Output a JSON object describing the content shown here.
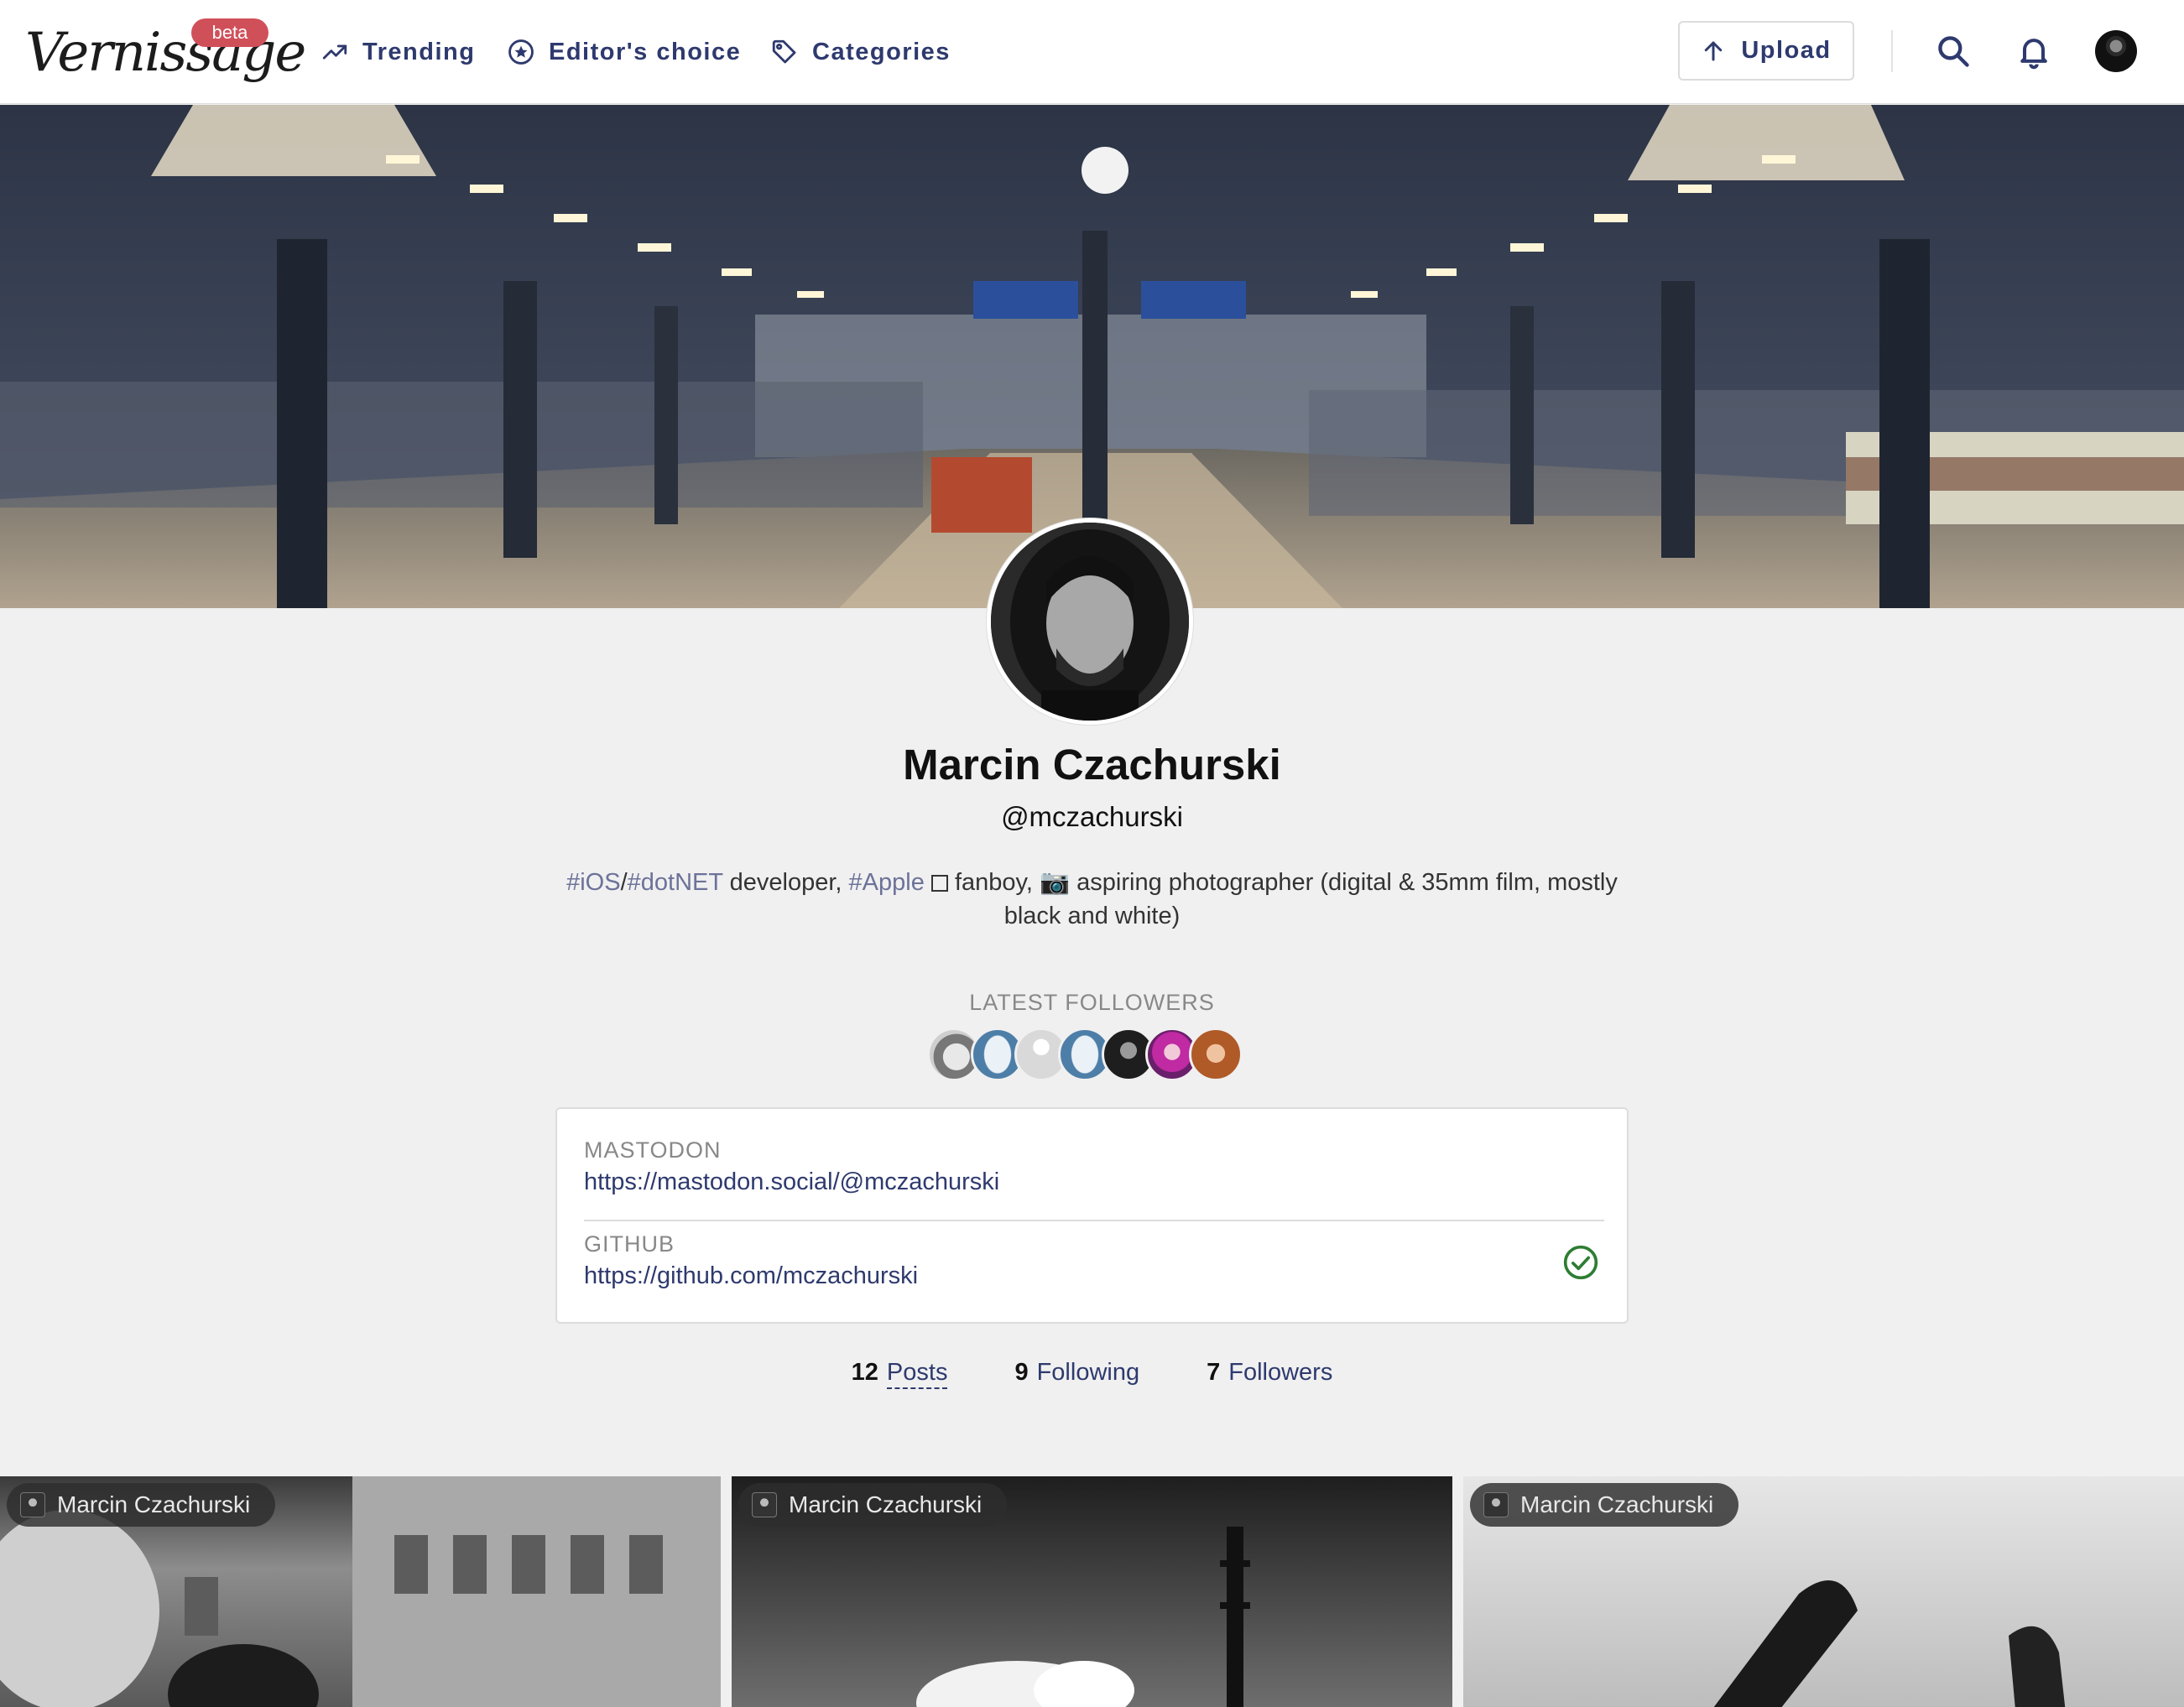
{
  "navbar": {
    "logo": "Vernissage",
    "beta_label": "beta",
    "links": [
      {
        "label": "Trending",
        "icon": "trending-up-icon"
      },
      {
        "label": "Editor's choice",
        "icon": "star-circle-icon"
      },
      {
        "label": "Categories",
        "icon": "tag-icon"
      }
    ],
    "upload_label": "Upload",
    "search_icon": "search-icon",
    "notifications_icon": "bell-icon",
    "avatar": "user-avatar"
  },
  "profile": {
    "name": "Marcin Czachurski",
    "handle": "@mczachurski",
    "bio": {
      "tag_ios": "#iOS",
      "slash": "/",
      "tag_dotnet": "#dotNET",
      "text1": " developer, ",
      "tag_apple": "#Apple",
      "text2": " fanboy, 📷 aspiring photographer (digital & 35mm film, mostly black and white)"
    }
  },
  "latest_followers": {
    "title": "LATEST FOLLOWERS",
    "count_shown": 7
  },
  "fields": [
    {
      "name": "MASTODON",
      "value": "https://mastodon.social/@mczachurski",
      "verified": false
    },
    {
      "name": "GITHUB",
      "value": "https://github.com/mczachurski",
      "verified": true
    }
  ],
  "stats": {
    "posts": {
      "count": "12",
      "label": "Posts"
    },
    "following": {
      "count": "9",
      "label": "Following"
    },
    "followers": {
      "count": "7",
      "label": "Followers"
    }
  },
  "posts": [
    {
      "author": "Marcin Czachurski"
    },
    {
      "author": "Marcin Czachurski"
    },
    {
      "author": "Marcin Czachurski"
    }
  ],
  "colors": {
    "accent": "#2e3a6e",
    "beta_badge": "#d0505a",
    "hashtag": "#6c7299",
    "verified": "#2e7d32",
    "background": "#f0f0f0"
  }
}
